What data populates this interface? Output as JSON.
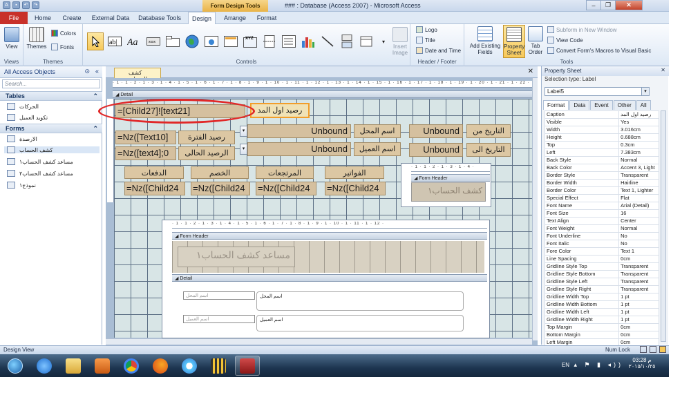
{
  "window": {
    "title": "### : Database (Access 2007) - Microsoft Access",
    "context_tab": "Form Design Tools",
    "controls": [
      "–",
      "❐",
      "✕"
    ]
  },
  "ribbon_tabs": [
    "File",
    "Home",
    "Create",
    "External Data",
    "Database Tools",
    "Design",
    "Arrange",
    "Format"
  ],
  "ribbon": {
    "views": {
      "view_label": "View",
      "group": "Views"
    },
    "themes": {
      "themes_label": "Themes",
      "colors_label": "Colors",
      "fonts_label": "Fonts",
      "group": "Themes"
    },
    "controls_group": "Controls",
    "insert_image": "Insert Image",
    "header_footer": {
      "logo": "Logo",
      "title": "Title",
      "date_time": "Date and Time",
      "group": "Header / Footer"
    },
    "tools": {
      "add_existing_fields": "Add Existing Fields",
      "property_sheet": "Property Sheet",
      "tab_order": "Tab Order",
      "subform_new_window": "Subform in New Window",
      "view_code": "View Code",
      "convert_macros": "Convert Form's Macros to Visual Basic",
      "group": "Tools"
    }
  },
  "nav": {
    "header": "All Access Objects",
    "search_placeholder": "Search...",
    "tables_label": "Tables",
    "tables": [
      "الحركات",
      "تكويد العميل"
    ],
    "forms_label": "Forms",
    "forms": [
      "الارصدة",
      "كشف الحساب",
      "مساعد كشف الحساب١",
      "مساعد كشف الحساب٢",
      "نموذج١"
    ]
  },
  "document": {
    "tab_label": "كشف الحساب",
    "detail_section": "Detail",
    "form_header_section": "Form Header",
    "controls": {
      "child27": "=[Child27]![text21]",
      "lbl_opening": "رصيد اول المد",
      "nz_text10": "=Nz([Text10]",
      "lbl_period": "رصيد الفترة",
      "nz_text4": "=Nz([text4];0",
      "lbl_current": "الرصيد الحالى",
      "unbound1": "Unbound",
      "lbl_shop": "اسم المحل",
      "unbound2": "Unbound",
      "lbl_client": "اسم العميل",
      "unbound3": "Unbound",
      "lbl_date_from": "التاريخ من",
      "unbound4": "Unbound",
      "lbl_date_to": "التاريخ الى",
      "lbl_payments": "الدفعات",
      "lbl_discount": "الخصم",
      "lbl_returns": "المرتجعات",
      "lbl_invoices": "الفواتير",
      "nz_child1": "=Nz([Child24",
      "nz_child2": "=Nz([Child24",
      "nz_child3": "=Nz([Child24",
      "nz_child4": "=Nz([Child24"
    },
    "subform1_caption": "كشف الحساب١",
    "subform2_caption": "مساعد كشف الحساب١",
    "subform2_fields": {
      "shop_label": "اسم المحل",
      "shop_box": "اسم المحل",
      "client_label": "اسم العميل",
      "client_box": "اسم العميل"
    }
  },
  "property_sheet": {
    "title": "Property Sheet",
    "selection_type": "Selection type:  Label",
    "selected_control": "Label5",
    "tabs": [
      "Format",
      "Data",
      "Event",
      "Other",
      "All"
    ],
    "rows": [
      [
        "Caption",
        "رصيد اول المد"
      ],
      [
        "Visible",
        "Yes"
      ],
      [
        "Width",
        "3.016cm"
      ],
      [
        "Height",
        "0.688cm"
      ],
      [
        "Top",
        "0.3cm"
      ],
      [
        "Left",
        "7.383cm"
      ],
      [
        "Back Style",
        "Normal"
      ],
      [
        "Back Color",
        "Accent 3, Light"
      ],
      [
        "Border Style",
        "Transparent"
      ],
      [
        "Border Width",
        "Hairline"
      ],
      [
        "Border Color",
        "Text 1, Lighter"
      ],
      [
        "Special Effect",
        "Flat"
      ],
      [
        "Font Name",
        "Arial (Detail)"
      ],
      [
        "Font Size",
        "16"
      ],
      [
        "Text Align",
        "Center"
      ],
      [
        "Font Weight",
        "Normal"
      ],
      [
        "Font Underline",
        "No"
      ],
      [
        "Font Italic",
        "No"
      ],
      [
        "Fore Color",
        "Text 1"
      ],
      [
        "Line Spacing",
        "0cm"
      ],
      [
        "Gridline Style Top",
        "Transparent"
      ],
      [
        "Gridline Style Bottom",
        "Transparent"
      ],
      [
        "Gridline Style Left",
        "Transparent"
      ],
      [
        "Gridline Style Right",
        "Transparent"
      ],
      [
        "Gridline Width Top",
        "1 pt"
      ],
      [
        "Gridline Width Bottom",
        "1 pt"
      ],
      [
        "Gridline Width Left",
        "1 pt"
      ],
      [
        "Gridline Width Right",
        "1 pt"
      ],
      [
        "Top Margin",
        "0cm"
      ],
      [
        "Bottom Margin",
        "0cm"
      ],
      [
        "Left Margin",
        "0cm"
      ]
    ]
  },
  "status": {
    "left": "Design View",
    "right": "Num Lock"
  },
  "taskbar": {
    "lang": "EN",
    "time": "03:28 م",
    "date": "٢٠١٥/١٠/٢٥"
  },
  "colors": {
    "accent_file": "#c8312a",
    "selection": "#f29e2a",
    "ellipse": "#e12828",
    "grid": "#d8e5e6"
  }
}
